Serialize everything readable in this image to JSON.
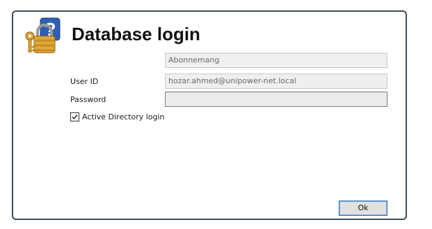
{
  "dialog": {
    "title": "Database login",
    "icon": "padlock-question-icon"
  },
  "form": {
    "subscription": {
      "value": "Abonnemang"
    },
    "user_id": {
      "label": "User ID",
      "value": "hozar.ahmed@unipower-net.local"
    },
    "password": {
      "label": "Password",
      "value": ""
    },
    "active_directory": {
      "label": "Active Directory login",
      "checked": true
    }
  },
  "buttons": {
    "ok_label": "Ok"
  },
  "colors": {
    "frame_border": "#3b4a5c",
    "disabled_field_bg": "#efefef",
    "button_focus_border": "#2f6db5"
  }
}
